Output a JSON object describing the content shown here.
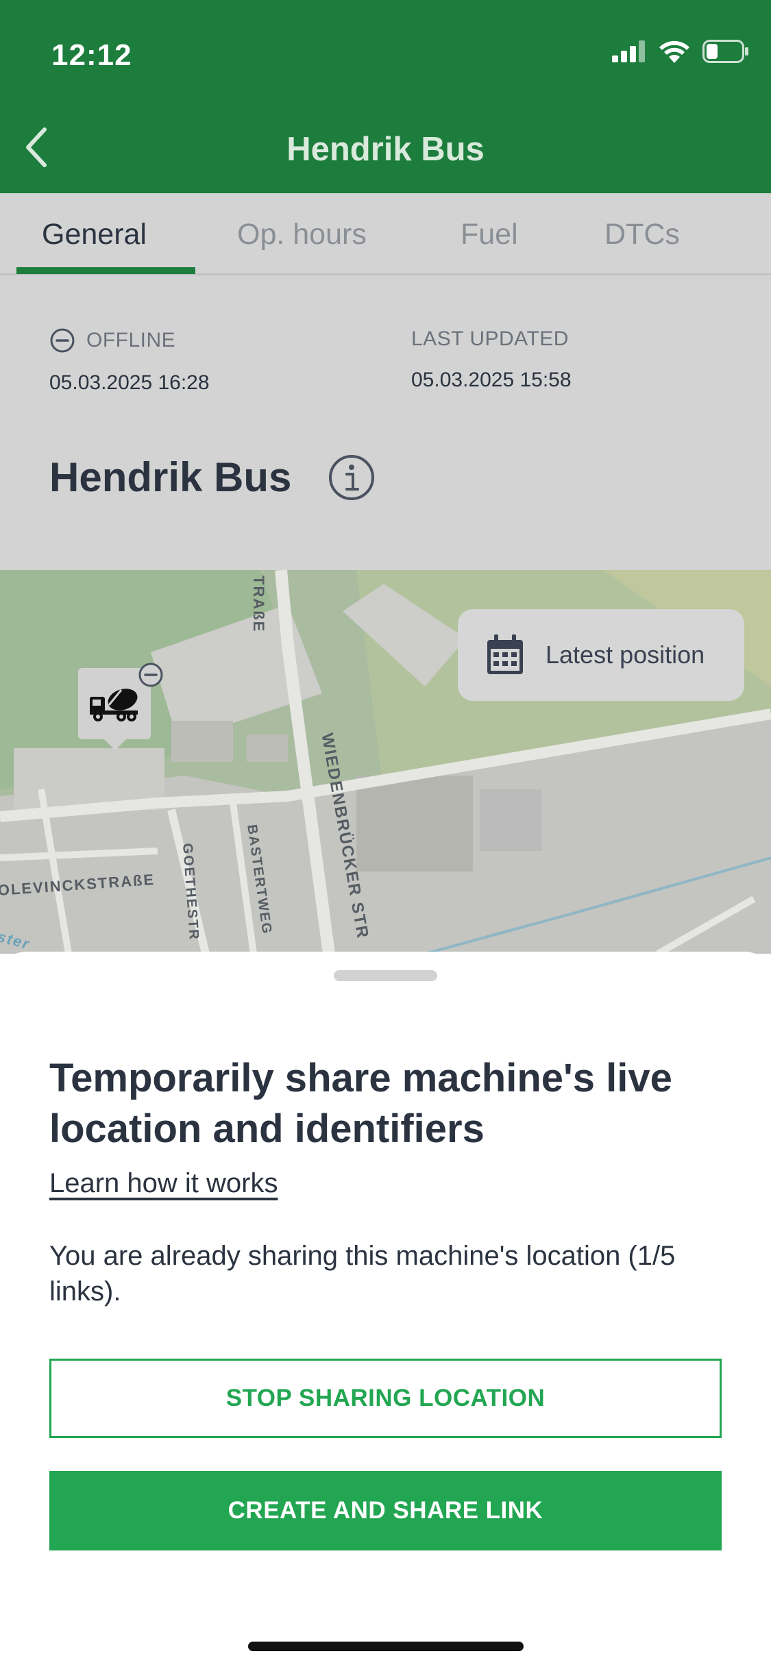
{
  "status_bar": {
    "time": "12:12"
  },
  "nav": {
    "title": "Hendrik Bus",
    "back_icon": "chevron-left-icon"
  },
  "tabs": [
    {
      "label": "General",
      "active": true
    },
    {
      "label": "Op. hours",
      "active": false
    },
    {
      "label": "Fuel",
      "active": false
    },
    {
      "label": "DTCs",
      "active": false
    }
  ],
  "machine": {
    "status_label": "OFFLINE",
    "status_time": "05.03.2025 16:28",
    "last_updated_label": "LAST UPDATED",
    "last_updated_time": "05.03.2025 15:58",
    "name": "Hendrik Bus"
  },
  "map": {
    "latest_position_label": "Latest position",
    "streets": [
      "TRAßE",
      "WIEDENBRÜCKER STR",
      "BASTERTWEG",
      "GOETHESTR",
      "OLEVINCKSTRAßE",
      "ster"
    ]
  },
  "sheet": {
    "title": "Temporarily share machine's live location and identifiers",
    "learn_link": "Learn how it works",
    "description": "You are already sharing this machine's location (1/5 links).",
    "stop_button": "STOP SHARING LOCATION",
    "create_button": "CREATE AND SHARE LINK"
  },
  "colors": {
    "header": "#1c7d3d",
    "accent": "#22a652",
    "text": "#2b3340"
  }
}
